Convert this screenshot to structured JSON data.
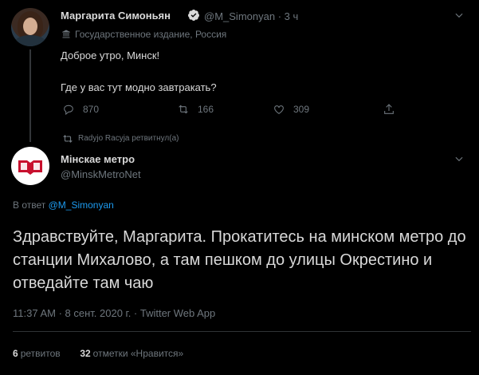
{
  "tweet1": {
    "author_name": "Маргарита Симоньян",
    "handle": "@M_Simonyan",
    "time": "· 3 ч",
    "state_label": "Государственное издание, Россия",
    "text_line1": "Доброе утро, Минск!",
    "text_line2": "Где у вас тут модно завтракать?",
    "replies": "870",
    "retweets": "166",
    "likes": "309"
  },
  "retweet_note": "Radyjo Racyja ретвитнул(а)",
  "tweet2": {
    "author_name": "Мінскае метро",
    "handle": "@MinskMetroNet",
    "reply_prefix": "В ответ ",
    "reply_mention": "@M_Simonyan",
    "text": "Здравствуйте, Маргарита. Прокатитесь на минском метро до станции Михалово, а там пешком до улицы Окрестино и отведайте там чаю",
    "meta": "11:37 AM · 8 сент. 2020 г. · Twitter Web App",
    "retweets_count": "6",
    "retweets_label": "ретвитов",
    "likes_count": "32",
    "likes_label": "отметки «Нравится»"
  },
  "colors": {
    "background": "#000000",
    "text": "#d9d9d9",
    "muted": "#6e767d",
    "link": "#1d9bf0",
    "verified": "#d9d9d9",
    "metro_logo": "#c8102e"
  },
  "icons": [
    "verified-icon",
    "chevron-down-icon",
    "state-media-icon",
    "reply-icon",
    "retweet-icon",
    "like-icon",
    "share-icon",
    "metro-logo-icon"
  ]
}
